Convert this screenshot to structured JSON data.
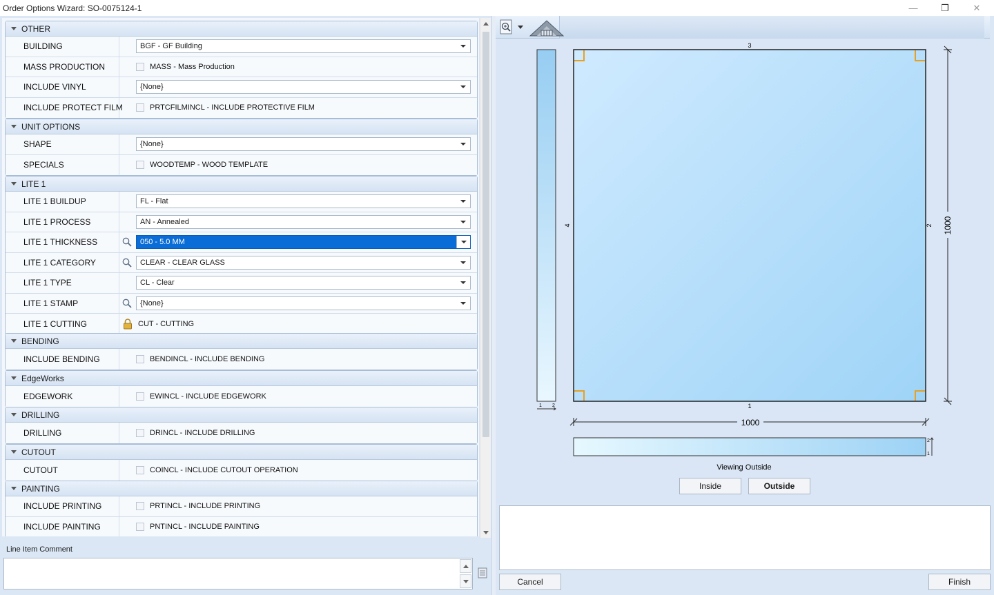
{
  "window": {
    "title": "Order Options Wizard: SO-0075124-1",
    "minimize_glyph": "—",
    "restore_glyph": "❐",
    "close_glyph": "✕"
  },
  "sections": {
    "other": {
      "title": "OTHER",
      "building_label": "BUILDING",
      "building_value": "BGF - GF Building",
      "mass_production_label": "MASS PRODUCTION",
      "mass_production_text": "MASS - Mass Production",
      "include_vinyl_label": "INCLUDE VINYL",
      "include_vinyl_value": "{None}",
      "include_protect_film_label": "INCLUDE PROTECT FILM",
      "include_protect_film_text": "PRTCFILMINCL - INCLUDE PROTECTIVE FILM"
    },
    "unit_options": {
      "title": "UNIT OPTIONS",
      "shape_label": "SHAPE",
      "shape_value": "{None}",
      "specials_label": "SPECIALS",
      "specials_text": "WOODTEMP - WOOD TEMPLATE"
    },
    "lite1": {
      "title": "LITE 1",
      "buildup_label": "LITE 1 BUILDUP",
      "buildup_value": "FL - Flat",
      "process_label": "LITE 1 PROCESS",
      "process_value": "AN - Annealed",
      "thickness_label": "LITE 1 THICKNESS",
      "thickness_value": "050 - 5.0 MM",
      "category_label": "LITE 1 CATEGORY",
      "category_value": "CLEAR - CLEAR GLASS",
      "type_label": "LITE 1 TYPE",
      "type_value": "CL - Clear",
      "stamp_label": "LITE 1 STAMP",
      "stamp_value": "{None}",
      "cutting_label": "LITE 1 CUTTING",
      "cutting_text": "CUT - CUTTING"
    },
    "bending": {
      "title": "BENDING",
      "include_label": "INCLUDE BENDING",
      "include_text": "BENDINCL - INCLUDE BENDING"
    },
    "edgeworks": {
      "title": "EdgeWorks",
      "edgework_label": "EDGEWORK",
      "edgework_text": "EWINCL - INCLUDE EDGEWORK"
    },
    "drilling": {
      "title": "DRILLING",
      "drilling_label": "DRILLING",
      "drilling_text": "DRINCL - INCLUDE DRILLING"
    },
    "cutout": {
      "title": "CUTOUT",
      "cutout_label": "CUTOUT",
      "cutout_text": "COINCL - INCLUDE CUTOUT OPERATION"
    },
    "painting": {
      "title": "PAINTING",
      "printing_label": "INCLUDE PRINTING",
      "printing_text": "PRTINCL - INCLUDE PRINTING",
      "painting_label": "INCLUDE PAINTING",
      "painting_text": "PNTINCL - INCLUDE PAINTING"
    }
  },
  "comment": {
    "label": "Line Item Comment",
    "value": ""
  },
  "preview": {
    "top_edge": "3",
    "bottom_edge": "1",
    "left_edge": "4",
    "right_edge": "2",
    "width_dim": "1000",
    "height_dim": "1000",
    "side_bottom_a": "1",
    "side_bottom_b": "2",
    "bottom_right_a": "2",
    "bottom_right_b": "1",
    "viewing_label": "Viewing Outside",
    "inside_button": "Inside",
    "outside_button": "Outside"
  },
  "footer": {
    "cancel_button": "Cancel",
    "finish_button": "Finish",
    "note_value": ""
  },
  "colors": {
    "accent_selected": "#0a6cd6",
    "glass_fill_top": "#cfeaff",
    "glass_fill_bottom": "#9fd4f7",
    "corner_marker": "#e8a020"
  }
}
